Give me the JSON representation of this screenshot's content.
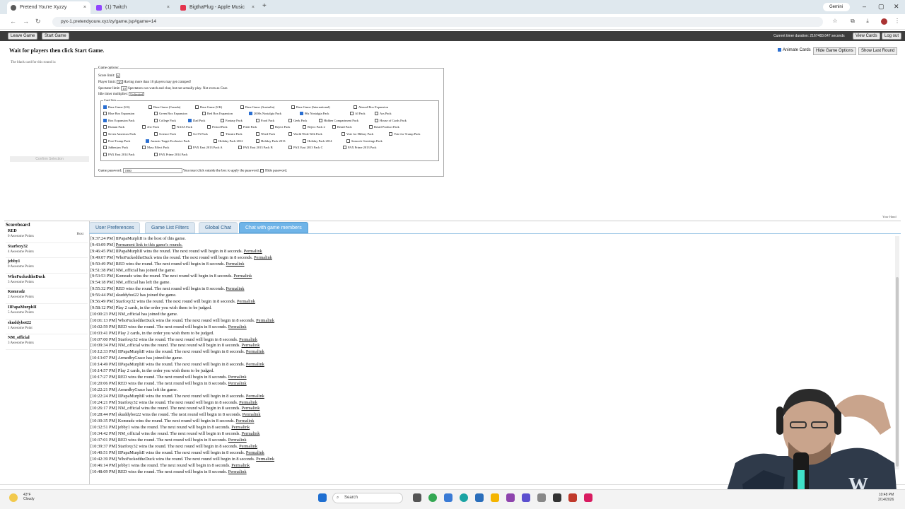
{
  "browser": {
    "tabs": [
      {
        "title": "Pretend You're Xyzzy",
        "favicon_color": "#5a5a5a"
      },
      {
        "title": "(1) Twitch",
        "favicon_color": "#9146ff"
      },
      {
        "title": "BigthaPlug - Apple Music",
        "favicon_color": "#e4334d"
      }
    ],
    "tab_icons": {
      "close": "×",
      "new_tab": "+",
      "gemini_label": "Gemini"
    },
    "window_controls": [
      "–",
      "▢",
      "✕"
    ],
    "url": "pyx-1.pretendyoure.xyz/zy/game.jsp#game=14"
  },
  "game_header": {
    "leave_label": "Leave Game",
    "start_label": "Start Game",
    "duration_text": "Current timer duration: 2167483.647 seconds",
    "view_cards_label": "View Cards",
    "logout_label": "Log out"
  },
  "instructions": {
    "heading": "Wait for players then click Start Game.",
    "black_card_text": "The black card for this round is:",
    "confirm_label": "Confirm Selection"
  },
  "right_controls": {
    "animate_label": "Animate Cards",
    "hide_options_label": "Hide Game Options",
    "show_last_round_label": "Show Last Round"
  },
  "options": {
    "legend": "Game options:",
    "score_limit_label": "Score limit:",
    "score_limit_value": "6",
    "player_limit_label": "Player limit:",
    "player_limit_value": "20",
    "player_limit_note": "Having more than 10 players may get cramped!",
    "spectator_limit_label": "Spectator limit:",
    "spectator_limit_value": "10",
    "spectator_note": "Spectators can watch and chat, but not actually play. Not even as Czar.",
    "idle_label": "Idle timer multiplier:",
    "idle_value": "Unlimited",
    "card_sets_legend": "Card Sets",
    "password_label": "Game password:",
    "password_value": "1980",
    "password_note": "You must click outside the box to apply the password.",
    "hide_password_label": "Hide password."
  },
  "card_sets": [
    {
      "label": "Base Game (US)",
      "checked": true
    },
    {
      "label": "Base Game (Canada)",
      "checked": false
    },
    {
      "label": "Base Game (UK)",
      "checked": false
    },
    {
      "label": "Base Game (Australia)",
      "checked": false
    },
    {
      "label": "Base Game (International)",
      "checked": false
    },
    {
      "label": "Absurd Box Expansion",
      "checked": false
    },
    {
      "label": "Blue Box Expansion",
      "checked": false
    },
    {
      "label": "Green Box Expansion",
      "checked": false
    },
    {
      "label": "Red Box Expansion",
      "checked": false
    },
    {
      "label": "2000s Nostalgia Pack",
      "checked": true
    },
    {
      "label": "90s Nostalgia Pack",
      "checked": true
    },
    {
      "label": "AI Pack",
      "checked": false
    },
    {
      "label": "Ass Pack",
      "checked": false
    },
    {
      "label": "Box Expansion Pack",
      "checked": true
    },
    {
      "label": "College Pack",
      "checked": false
    },
    {
      "label": "Dad Pack",
      "checked": true
    },
    {
      "label": "Fantasy Pack",
      "checked": false
    },
    {
      "label": "Food Pack",
      "checked": false
    },
    {
      "label": "Geek Pack",
      "checked": false
    },
    {
      "label": "Hidden Compartment Pack",
      "checked": false
    },
    {
      "label": "House of Cards Pack",
      "checked": false
    },
    {
      "label": "Human Pack",
      "checked": false
    },
    {
      "label": "Jew Pack",
      "checked": false
    },
    {
      "label": "NASA Pack",
      "checked": false
    },
    {
      "label": "Period Pack",
      "checked": false
    },
    {
      "label": "Pride Pack",
      "checked": false
    },
    {
      "label": "Reject Pack",
      "checked": false
    },
    {
      "label": "Reject Pack 2",
      "checked": false
    },
    {
      "label": "Retail Pack",
      "checked": false
    },
    {
      "label": "Retail Product Pack",
      "checked": false
    },
    {
      "label": "Seven Americas Pack",
      "checked": false
    },
    {
      "label": "Science Pack",
      "checked": false
    },
    {
      "label": "Sci-Fi Pack",
      "checked": false
    },
    {
      "label": "Theatre Pack",
      "checked": false
    },
    {
      "label": "Weed Pack",
      "checked": false
    },
    {
      "label": "World Wide Web Pack",
      "checked": false
    },
    {
      "label": "Vote for Hillary Pack",
      "checked": false
    },
    {
      "label": "Vote for Trump Pack",
      "checked": false
    },
    {
      "label": "Post-Trump Pack",
      "checked": false
    },
    {
      "label": "Jurassic Target Exclusive Pack",
      "checked": true
    },
    {
      "label": "Holiday Pack 2012",
      "checked": false
    },
    {
      "label": "Holiday Pack 2013",
      "checked": false
    },
    {
      "label": "Holiday Pack 2014",
      "checked": false
    },
    {
      "label": "Season's Greetings Pack",
      "checked": false
    },
    {
      "label": "Jabberjaw Pack",
      "checked": false
    },
    {
      "label": "Mass Effect Pack",
      "checked": false
    },
    {
      "label": "PAX East 2013 Pack A",
      "checked": false
    },
    {
      "label": "PAX East 2013 Pack B",
      "checked": false
    },
    {
      "label": "PAX East 2013 Pack C",
      "checked": false
    },
    {
      "label": "PAX Prime 2013 Pack",
      "checked": false
    },
    {
      "label": "PAX East 2014 Pack",
      "checked": false
    },
    {
      "label": "PAX Prime 2014 Pack",
      "checked": false
    }
  ],
  "your_hand_label": "Your Hand",
  "scoreboard": {
    "title": "Scoreboard",
    "players": [
      {
        "name": "RED",
        "score": "0 Awesome Points",
        "status": "Host"
      },
      {
        "name": "Starfoxy32",
        "score": "4 Awesome Points",
        "status": ""
      },
      {
        "name": "jebby1",
        "score": "0 Awesome Points",
        "status": ""
      },
      {
        "name": "WhoFuckedtheDuck",
        "score": "3 Awesome Points",
        "status": ""
      },
      {
        "name": "Komradz",
        "score": "2 Awesome Points",
        "status": ""
      },
      {
        "name": "IIPapaMurphII",
        "score": "5 Awesome Points",
        "status": ""
      },
      {
        "name": "skuddybot22",
        "score": "1 Awesome Point",
        "status": ""
      },
      {
        "name": "NM_official",
        "score": "3 Awesome Points",
        "status": ""
      }
    ]
  },
  "chat_tabs": [
    {
      "label": "User Preferences",
      "active": false
    },
    {
      "label": "Game List Filters",
      "active": false
    },
    {
      "label": "Global Chat",
      "active": false
    },
    {
      "label": "Chat with game members",
      "active": true
    }
  ],
  "chat_log": [
    {
      "time": "[9:37:24 PM]",
      "text": "IIPapaMurphII is the host of this game.",
      "link": ""
    },
    {
      "time": "[9:43:09 PM]",
      "text": "",
      "link": "Permanent link to this game's rounds."
    },
    {
      "time": "[9:46:45 PM]",
      "text": "IIPapaMurphII wins the round. The next round will begin in 8 seconds.",
      "link": "Permalink"
    },
    {
      "time": "[9:49:07 PM]",
      "text": "WhoFuckedtheDuck wins the round. The next round will begin in 8 seconds.",
      "link": "Permalink"
    },
    {
      "time": "[9:50:49 PM]",
      "text": "RED wins the round. The next round will begin in 8 seconds.",
      "link": "Permalink"
    },
    {
      "time": "[9:51:38 PM]",
      "text": "NM_official has joined the game.",
      "link": ""
    },
    {
      "time": "[9:53:53 PM]",
      "text": "Komradz wins the round. The next round will begin in 8 seconds.",
      "link": "Permalink"
    },
    {
      "time": "[9:54:18 PM]",
      "text": "NM_official has left the game.",
      "link": ""
    },
    {
      "time": "[9:55:32 PM]",
      "text": "RED wins the round. The next round will begin in 8 seconds.",
      "link": "Permalink"
    },
    {
      "time": "[9:56:44 PM]",
      "text": "skuddybot22 has joined the game.",
      "link": ""
    },
    {
      "time": "[9:56:49 PM]",
      "text": "Starfoxy32 wins the round. The next round will begin in 8 seconds.",
      "link": "Permalink"
    },
    {
      "time": "[9:58:12 PM]",
      "text": "Play 2 cards, in the order you wish them to be judged.",
      "link": ""
    },
    {
      "time": "[10:00:23 PM]",
      "text": "NM_official has joined the game.",
      "link": ""
    },
    {
      "time": "[10:01:13 PM]",
      "text": "WhoFuckedtheDuck wins the round. The next round will begin in 8 seconds.",
      "link": "Permalink"
    },
    {
      "time": "[10:02:59 PM]",
      "text": "RED wins the round. The next round will begin in 8 seconds.",
      "link": "Permalink"
    },
    {
      "time": "[10:03:41 PM]",
      "text": "Play 2 cards, in the order you wish them to be judged.",
      "link": ""
    },
    {
      "time": "[10:07:00 PM]",
      "text": "Starfoxy32 wins the round. The next round will begin in 8 seconds.",
      "link": "Permalink"
    },
    {
      "time": "[10:09:34 PM]",
      "text": "NM_official wins the round. The next round will begin in 8 seconds.",
      "link": "Permalink"
    },
    {
      "time": "[10:12:33 PM]",
      "text": "IIPapaMurphII wins the round. The next round will begin in 8 seconds.",
      "link": "Permalink"
    },
    {
      "time": "[10:13:07 PM]",
      "text": "ArmedbyGrace has joined the game.",
      "link": ""
    },
    {
      "time": "[10:14:49 PM]",
      "text": "IIPapaMurphII wins the round. The next round will begin in 8 seconds.",
      "link": "Permalink"
    },
    {
      "time": "[10:14:57 PM]",
      "text": "Play 2 cards, in the order you wish them to be judged.",
      "link": ""
    },
    {
      "time": "[10:17:27 PM]",
      "text": "RED wins the round. The next round will begin in 8 seconds.",
      "link": "Permalink"
    },
    {
      "time": "[10:20:06 PM]",
      "text": "RED wins the round. The next round will begin in 8 seconds.",
      "link": "Permalink"
    },
    {
      "time": "[10:22:21 PM]",
      "text": "ArmedbyGrace has left the game.",
      "link": ""
    },
    {
      "time": "[10:22:24 PM]",
      "text": "IIPapaMurphII wins the round. The next round will begin in 8 seconds.",
      "link": "Permalink"
    },
    {
      "time": "[10:24:21 PM]",
      "text": "Starfoxy32 wins the round. The next round will begin in 8 seconds.",
      "link": "Permalink"
    },
    {
      "time": "[10:26:17 PM]",
      "text": "NM_official wins the round. The next round will begin in 8 seconds.",
      "link": "Permalink"
    },
    {
      "time": "[10:28:44 PM]",
      "text": "skuddybot22 wins the round. The next round will begin in 8 seconds.",
      "link": "Permalink"
    },
    {
      "time": "[10:30:35 PM]",
      "text": "Komradz wins the round. The next round will begin in 8 seconds.",
      "link": "Permalink"
    },
    {
      "time": "[10:32:51 PM]",
      "text": "jebby1 wins the round. The next round will begin in 8 seconds.",
      "link": "Permalink"
    },
    {
      "time": "[10:34:42 PM]",
      "text": "NM_official wins the round. The next round will begin in 8 seconds.",
      "link": "Permalink"
    },
    {
      "time": "[10:37:01 PM]",
      "text": "RED wins the round. The next round will begin in 8 seconds.",
      "link": "Permalink"
    },
    {
      "time": "[10:39:37 PM]",
      "text": "Starfoxy32 wins the round. The next round will begin in 8 seconds.",
      "link": "Permalink"
    },
    {
      "time": "[10:40:51 PM]",
      "text": "IIPapaMurphII wins the round. The next round will begin in 8 seconds.",
      "link": "Permalink"
    },
    {
      "time": "[10:42:39 PM]",
      "text": "WhoFuckedtheDuck wins the round. The next round will begin in 8 seconds.",
      "link": "Permalink"
    },
    {
      "time": "[10:46:14 PM]",
      "text": "jebby1 wins the round. The next round will begin in 8 seconds.",
      "link": "Permalink"
    },
    {
      "time": "[10:48:09 PM]",
      "text": "RED wins the round. The next round will begin in 8 seconds.",
      "link": "Permalink"
    }
  ],
  "taskbar": {
    "weather_temp": "43°F",
    "weather_text": "Cloudy",
    "search_label": "Search",
    "time": "10:48 PM",
    "date": "2/14/2026"
  },
  "colors": {
    "accent_tab": "#6fb4e8",
    "link": "#1a1aa6",
    "top_strip": "#3c3c3c"
  }
}
